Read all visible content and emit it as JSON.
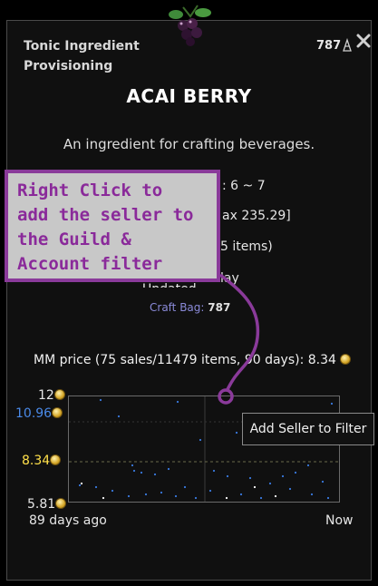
{
  "header": {
    "category": "Tonic Ingredient",
    "subcategory": "Provisioning",
    "count": "787"
  },
  "item": {
    "title": "ACAI BERRY",
    "description": "An ingredient for crafting beverages."
  },
  "stats": {
    "level_range": ": 6 ~ 7",
    "max_price": "ax 235.29]",
    "items_note": "5 items)",
    "updated": "Updated today",
    "updated_visible": "lay"
  },
  "craft_bag": {
    "label": "Craft Bag:",
    "value": "787"
  },
  "mm_price": {
    "text": "MM price (75 sales/11479 items, 90 days): 8.34"
  },
  "graph": {
    "y_labels": {
      "max": "12",
      "high": "10.96",
      "mid": "8.34",
      "min": "5.81"
    },
    "x_labels": {
      "start": "89 days ago",
      "end": "Now"
    },
    "colors": {
      "high": "#4a8ae8",
      "mid": "#ffe04a",
      "max": "#e6e6e6",
      "min": "#e6e6e6"
    }
  },
  "tooltip": {
    "text": "Add Seller to Filter"
  },
  "annotation": {
    "text": "Right Click to\nadd the seller to\nthe Guild &\nAccount filter",
    "color": "#8a3a9a"
  },
  "icons": [
    "acai-berry-icon",
    "close-icon",
    "provisioning-icon",
    "gold-coin-icon"
  ]
}
